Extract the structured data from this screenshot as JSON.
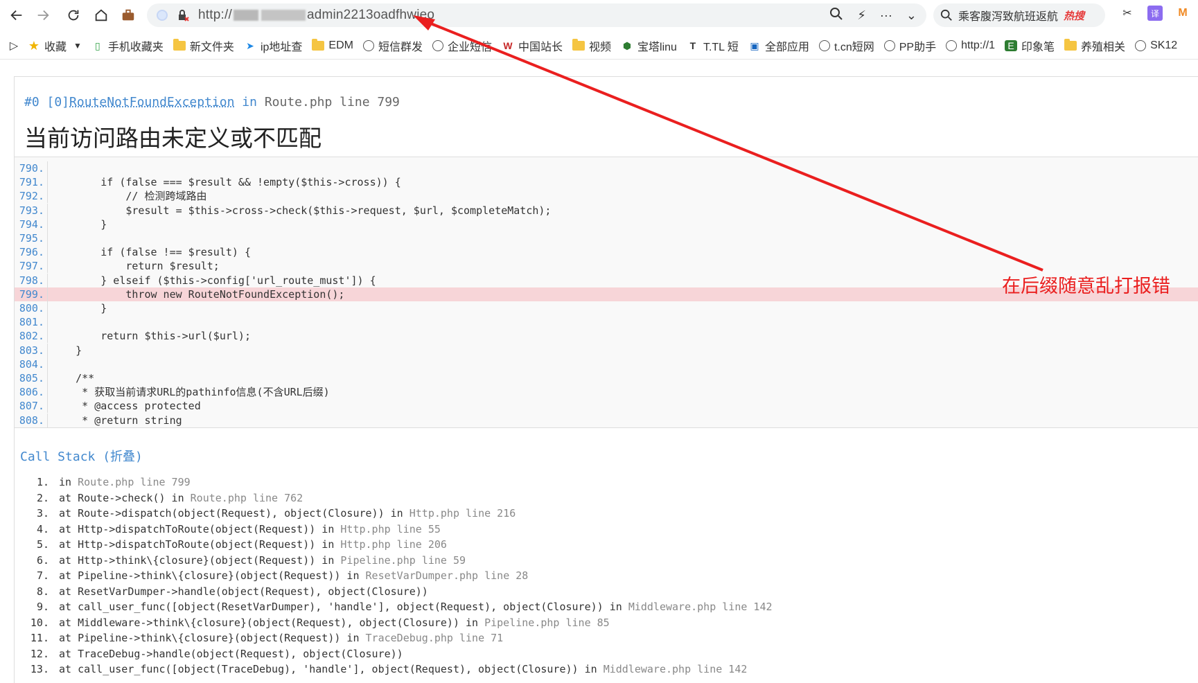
{
  "browser": {
    "url_prefix": "http://",
    "url_suffix": "admin2213oadfhwieo",
    "search_text": "乘客腹泻致航班返航",
    "search_hot": "热搜",
    "translate_icon": "译"
  },
  "bookmarks": {
    "items": [
      {
        "label": "收藏",
        "icon": "star-icon"
      },
      {
        "label": "手机收藏夹",
        "icon": "phone-icon"
      },
      {
        "label": "新文件夹",
        "icon": "folder-icon"
      },
      {
        "label": "ip地址查",
        "icon": "bolt-icon"
      },
      {
        "label": "EDM",
        "icon": "folder-icon"
      },
      {
        "label": "短信群发",
        "icon": "globe-icon"
      },
      {
        "label": "企业短信",
        "icon": "globe-icon"
      },
      {
        "label": "中国站长",
        "icon": "w-icon"
      },
      {
        "label": "视频",
        "icon": "folder-icon"
      },
      {
        "label": "宝塔linu",
        "icon": "shield-icon"
      },
      {
        "label": "T.TL 短",
        "icon": "t-icon"
      },
      {
        "label": "全部应用",
        "icon": "apps-icon"
      },
      {
        "label": "t.cn短网",
        "icon": "globe-icon"
      },
      {
        "label": "PP助手",
        "icon": "globe-icon"
      },
      {
        "label": "http://1",
        "icon": "globe-icon"
      },
      {
        "label": "印象笔",
        "icon": "evernote-icon"
      },
      {
        "label": "养殖相关",
        "icon": "folder-icon"
      },
      {
        "label": "SK12",
        "icon": "globe-icon"
      }
    ]
  },
  "exception": {
    "prefix": "#0 [0]",
    "class_name": "RouteNotFoundException",
    "in_word": " in ",
    "location": "Route.php line 799",
    "message": "当前访问路由未定义或不匹配"
  },
  "source": {
    "lines": [
      {
        "n": "790.",
        "code": ""
      },
      {
        "n": "791.",
        "code": "        if (false === $result && !empty($this->cross)) {"
      },
      {
        "n": "792.",
        "code": "            // 检测跨域路由"
      },
      {
        "n": "793.",
        "code": "            $result = $this->cross->check($this->request, $url, $completeMatch);"
      },
      {
        "n": "794.",
        "code": "        }"
      },
      {
        "n": "795.",
        "code": ""
      },
      {
        "n": "796.",
        "code": "        if (false !== $result) {"
      },
      {
        "n": "797.",
        "code": "            return $result;"
      },
      {
        "n": "798.",
        "code": "        } elseif ($this->config['url_route_must']) {"
      },
      {
        "n": "799.",
        "code": "            throw new RouteNotFoundException();"
      },
      {
        "n": "800.",
        "code": "        }"
      },
      {
        "n": "801.",
        "code": ""
      },
      {
        "n": "802.",
        "code": "        return $this->url($url);"
      },
      {
        "n": "803.",
        "code": "    }"
      },
      {
        "n": "804.",
        "code": ""
      },
      {
        "n": "805.",
        "code": "    /**"
      },
      {
        "n": "806.",
        "code": "     * 获取当前请求URL的pathinfo信息(不含URL后缀)"
      },
      {
        "n": "807.",
        "code": "     * @access protected"
      },
      {
        "n": "808.",
        "code": "     * @return string"
      }
    ]
  },
  "call_stack": {
    "title": "Call Stack (折叠)",
    "items": [
      {
        "n": "1.",
        "text": "in ",
        "loc": "Route.php line 799"
      },
      {
        "n": "2.",
        "text": "at Route->check() in ",
        "loc": "Route.php line 762"
      },
      {
        "n": "3.",
        "text": "at Route->dispatch(object(Request), object(Closure)) in ",
        "loc": "Http.php line 216"
      },
      {
        "n": "4.",
        "text": "at Http->dispatchToRoute(object(Request)) in ",
        "loc": "Http.php line 55"
      },
      {
        "n": "5.",
        "text": "at Http->dispatchToRoute(object(Request)) in ",
        "loc": "Http.php line 206"
      },
      {
        "n": "6.",
        "text": "at Http->think\\{closure}(object(Request)) in ",
        "loc": "Pipeline.php line 59"
      },
      {
        "n": "7.",
        "text": "at Pipeline->think\\{closure}(object(Request)) in ",
        "loc": "ResetVarDumper.php line 28"
      },
      {
        "n": "8.",
        "text": "at ResetVarDumper->handle(object(Request), object(Closure))",
        "loc": ""
      },
      {
        "n": "9.",
        "text": "at call_user_func([object(ResetVarDumper), 'handle'], object(Request), object(Closure)) in ",
        "loc": "Middleware.php line 142"
      },
      {
        "n": "10.",
        "text": "at Middleware->think\\{closure}(object(Request), object(Closure)) in ",
        "loc": "Pipeline.php line 85"
      },
      {
        "n": "11.",
        "text": "at Pipeline->think\\{closure}(object(Request)) in ",
        "loc": "TraceDebug.php line 71"
      },
      {
        "n": "12.",
        "text": "at TraceDebug->handle(object(Request), object(Closure))",
        "loc": ""
      },
      {
        "n": "13.",
        "text": "at call_user_func([object(TraceDebug), 'handle'], object(Request), object(Closure)) in ",
        "loc": "Middleware.php line 142"
      }
    ]
  },
  "annotation": {
    "text": "在后缀随意乱打报错",
    "color": "#ea1f1f"
  }
}
